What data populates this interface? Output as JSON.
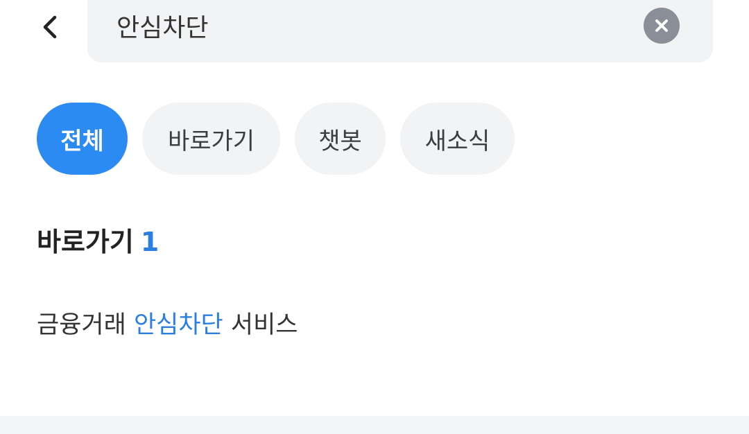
{
  "header": {
    "back_icon": "chevron-left-icon",
    "search_value": "안심차단",
    "clear_icon": "close-circle-icon"
  },
  "chips": [
    {
      "label": "전체",
      "active": true
    },
    {
      "label": "바로가기",
      "active": false
    },
    {
      "label": "챗봇",
      "active": false
    },
    {
      "label": "새소식",
      "active": false
    }
  ],
  "section": {
    "title": "바로가기",
    "count": "1"
  },
  "results": [
    {
      "prefix": "금융거래 ",
      "highlight": "안심차단",
      "suffix": " 서비스"
    }
  ],
  "colors": {
    "accent": "#2c8bf2",
    "highlight_text": "#2c7fe0",
    "chip_bg": "#f1f3f5",
    "clear_bg": "#8a8f97"
  }
}
